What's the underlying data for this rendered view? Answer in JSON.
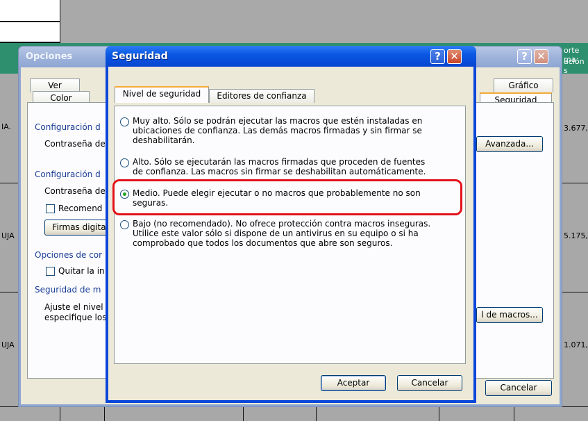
{
  "spreadsheet": {
    "right_header_1": "orte ma",
    "right_header_2": "ación s",
    "row_labels": [
      "IA.",
      "UJA",
      "UJA"
    ],
    "right_values": [
      "3.677,",
      "5.175,",
      "1.071,"
    ]
  },
  "opciones": {
    "title": "Opciones",
    "help_glyph": "?",
    "close_glyph": "✕",
    "tabs_row1": [
      "Ver",
      "Gráfico"
    ],
    "tabs_row2": [
      "Color",
      "Seguridad"
    ],
    "config1_heading": "Configuración d",
    "config1_pwd_label": "Contraseña de",
    "config2_heading": "Configuración d",
    "config2_pwd_label": "Contraseña de",
    "recommend_label": "Recomend",
    "digital_sig_button": "Firmas digita",
    "advanced_button": "Avanzada...",
    "privacy_heading": "Opciones de cor",
    "remove_info_label": "Quitar la in",
    "macro_heading": "Seguridad de m",
    "macro_text_1": "Ajuste el nivel",
    "macro_text_2": "especifique los",
    "macro_button": "l de macros...",
    "cancel_button": "Cancelar"
  },
  "seguridad": {
    "title": "Seguridad",
    "help_glyph": "?",
    "close_glyph": "✕",
    "tabs": [
      "Nivel de seguridad",
      "Editores de confianza"
    ],
    "options": [
      {
        "line1": "Muy alto. Sólo se podrán ejecutar las macros que estén instaladas en",
        "line2": "ubicaciones de confianza. Las demás macros firmadas y sin firmar se",
        "line3": "deshabilitarán.",
        "checked": false
      },
      {
        "line1": "Alto. Sólo se ejecutarán las macros firmadas que proceden de fuentes",
        "line2": "de confianza. Las macros sin firmar se deshabilitan automáticamente.",
        "line3": "",
        "checked": false
      },
      {
        "line1": "Medio. Puede elegir ejecutar o no macros que probablemente no son",
        "line2": "seguras.",
        "line3": "",
        "checked": true
      },
      {
        "line1": "Bajo (no recomendado). No ofrece protección contra macros inseguras.",
        "line2": "Utilice este valor sólo si dispone de un antivirus en su equipo o si ha",
        "line3": "comprobado que todos los documentos que abre son seguros.",
        "checked": false
      }
    ],
    "ok_button": "Aceptar",
    "cancel_button": "Cancelar",
    "highlight_color": "#e3121a"
  }
}
